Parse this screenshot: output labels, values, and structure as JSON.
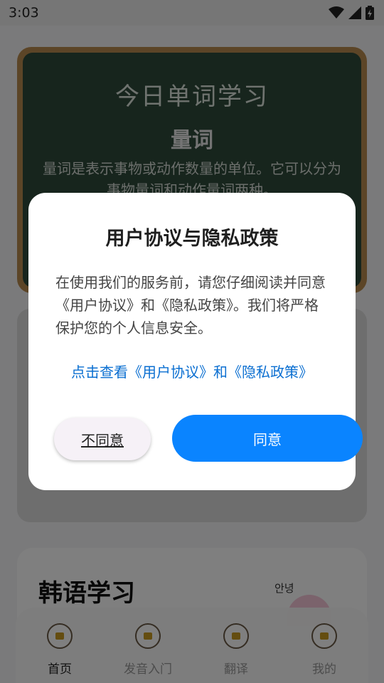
{
  "status_bar": {
    "time": "3:03"
  },
  "board": {
    "title": "今日单词学习",
    "word": "量词",
    "description": "量词是表示事物或动作数量的单位。它可以分为事物量词和动作量词两种。"
  },
  "korean_card": {
    "title": "韩语学习",
    "greeting": "안녕"
  },
  "bottom_nav": {
    "items": [
      {
        "label": "首页",
        "active": true,
        "icon": "home-icon"
      },
      {
        "label": "发音入门",
        "active": false,
        "icon": "book-icon"
      },
      {
        "label": "翻译",
        "active": false,
        "icon": "note-icon"
      },
      {
        "label": "我的",
        "active": false,
        "icon": "user-icon"
      }
    ]
  },
  "dialog": {
    "title": "用户协议与隐私政策",
    "body": "在使用我们的服务前，请您仔细阅读并同意《用户协议》和《隐私政策》。我们将严格保护您的个人信息安全。",
    "link": "点击查看《用户协议》和《隐私政策》",
    "disagree_label": "不同意",
    "agree_label": "同意"
  },
  "colors": {
    "accent": "#0a84ff",
    "link": "#0b6fd1"
  }
}
